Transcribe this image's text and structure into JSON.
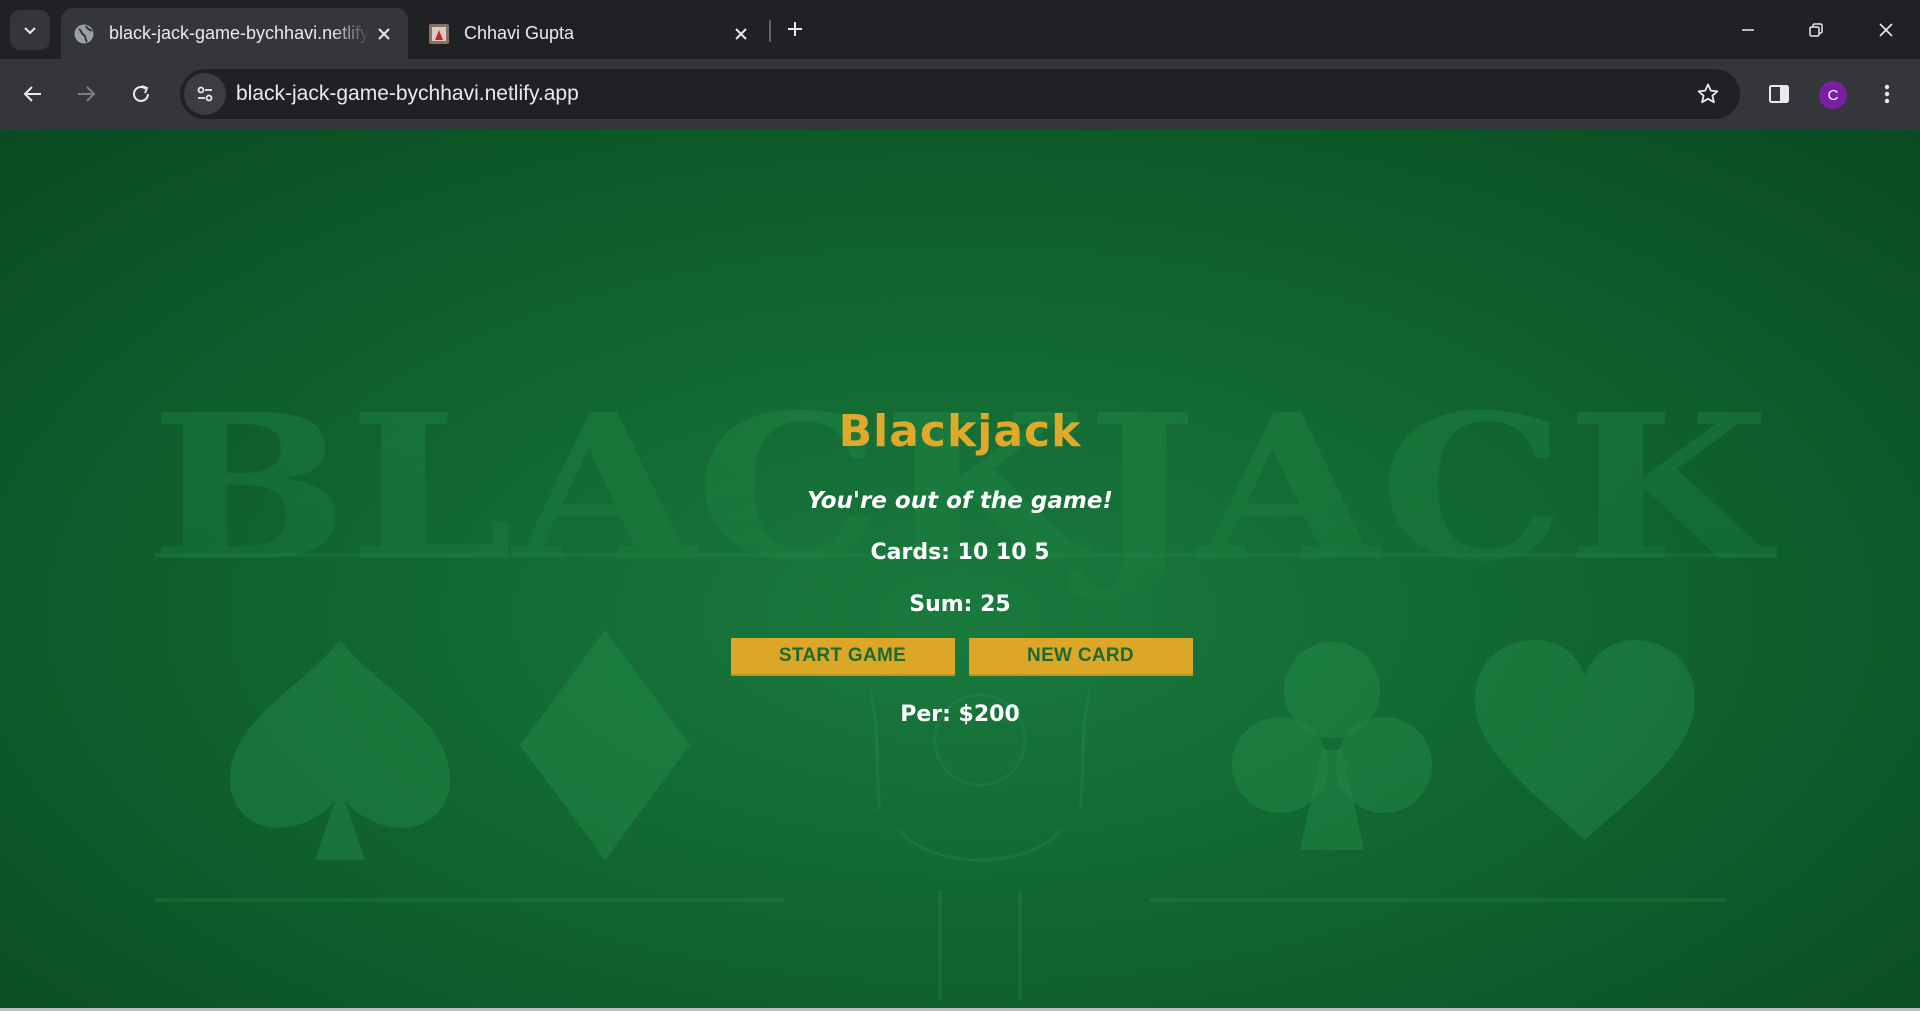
{
  "browser": {
    "tabs": [
      {
        "title": "black-jack-game-bychhavi.netlify.app",
        "active": true,
        "favicon": "globe-icon"
      },
      {
        "title": "Chhavi Gupta",
        "active": false,
        "favicon": "site-favicon"
      }
    ],
    "url": "black-jack-game-bychhavi.netlify.app",
    "profile_initial": "C",
    "profile_color": "#7b1fa2"
  },
  "background": {
    "watermark_text": "BLACKJACK"
  },
  "game": {
    "title": "Blackjack",
    "message": "You're out of the game!",
    "cards_text": "Cards: 10 10 5",
    "sum_text": "Sum: 25",
    "start_button": "START GAME",
    "new_card_button": "NEW CARD",
    "player_text": "Per: $200"
  },
  "colors": {
    "accent": "#e0a92a",
    "button_bg": "#dca626",
    "button_text": "#1a6b2f",
    "table_green": "#136a33"
  }
}
